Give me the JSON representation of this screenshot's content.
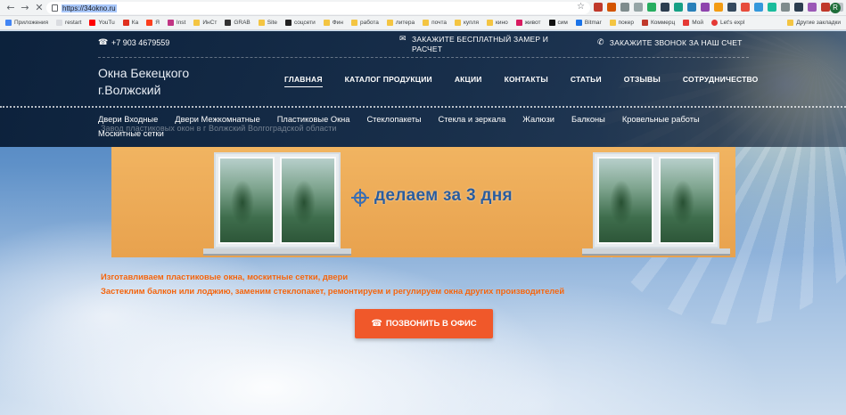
{
  "browser": {
    "url": "https://34okno.ru",
    "bookmarks": [
      "Приложения",
      "restart",
      "YouTu",
      "Ка",
      "Я",
      "Inst",
      "ИнСт",
      "GRAB",
      "Site",
      "соцсети",
      "Фин",
      "работа",
      "литера",
      "почта",
      "купля",
      "кино",
      "живот",
      "сим",
      "Bitmar",
      "покер",
      "Коммерц",
      "Мой",
      "Let's expl"
    ],
    "other_bookmarks": "Другие закладки",
    "profile_initial": "R"
  },
  "header": {
    "phone": "+7 903 4679559",
    "measure_cta": "ЗАКАЖИТЕ БЕСПЛАТНЫЙ ЗАМЕР И РАСЧЕТ",
    "callback_cta": "ЗАКАЖИТЕ ЗВОНОК ЗА НАШ СЧЕТ",
    "logo_line1": "Окна Бекецкого",
    "logo_line2": "г.Волжский"
  },
  "main_nav": [
    "ГЛАВНАЯ",
    "КАТАЛОГ ПРОДУКЦИИ",
    "АКЦИИ",
    "КОНТАКТЫ",
    "СТАТЬИ",
    "ОТЗЫВЫ",
    "СОТРУДНИЧЕСТВО"
  ],
  "sub_nav": [
    "Двери Входные",
    "Двери Межкомнатные",
    "Пластиковые Окна",
    "Стеклопакеты",
    "Стекла и зеркала",
    "Жалюзи",
    "Балконы",
    "Кровельные работы",
    "Москитные сетки"
  ],
  "ghost_text": "Завод пластиковых окон в г Волжский Волгоградской области",
  "banner": {
    "slogan": "делаем за 3 дня"
  },
  "content": {
    "line1": "Изготавливаем пластиковые окна, москитные сетки, двери",
    "line2": "Застеклим балкон или лоджию, заменим стеклопакет, ремонтируем и регулируем окна других производителей",
    "cta": "ПОЗВОНИТЬ В ОФИС"
  },
  "icons": {
    "phone": "phone-icon",
    "mail": "mail-icon",
    "callback": "phone-callback-icon",
    "crosshair": "crosshair-icon"
  },
  "colors": {
    "accent_orange": "#f0582a",
    "text_orange": "#f2630c",
    "header_dark": "#0a1e37",
    "banner_orange": "#e8a24e",
    "slogan_blue": "#2a5c9d"
  }
}
